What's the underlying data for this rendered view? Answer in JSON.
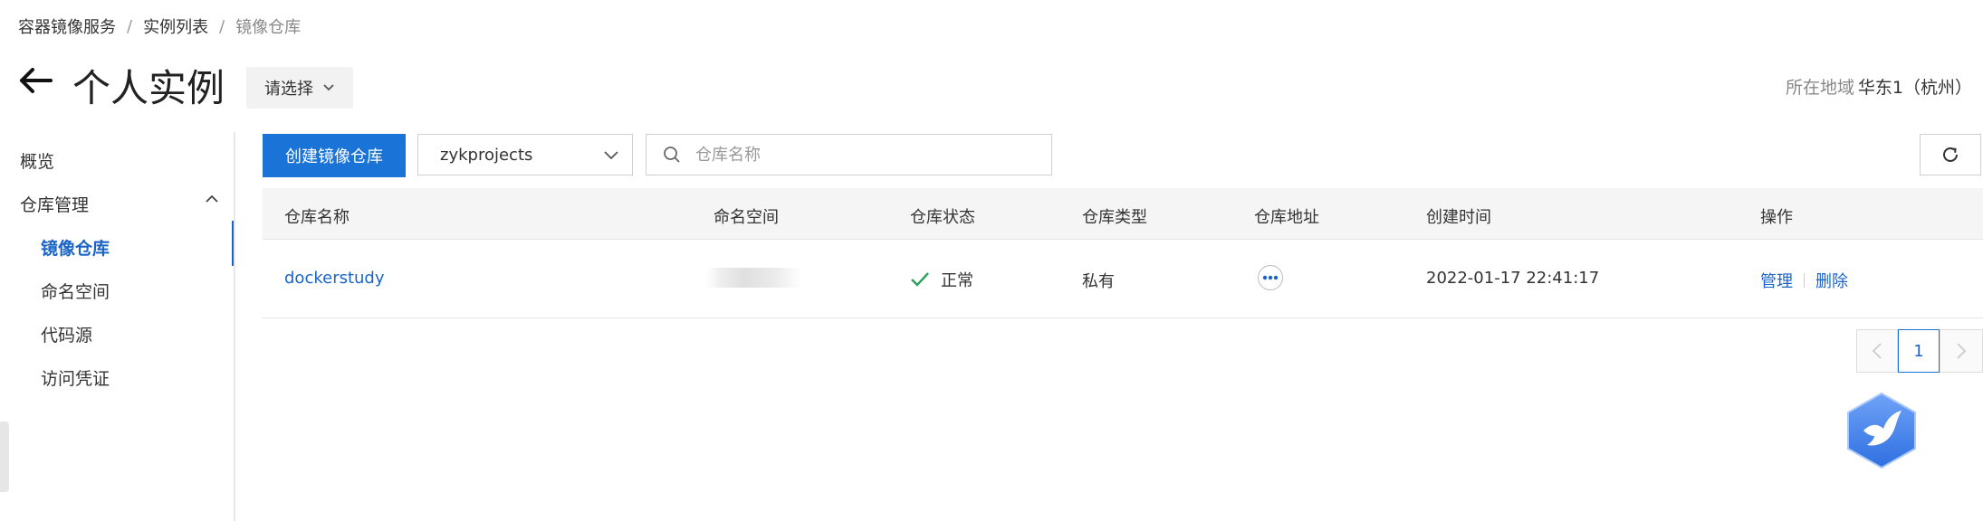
{
  "breadcrumb": [
    "容器镜像服务",
    "实例列表",
    "镜像仓库"
  ],
  "header": {
    "title": "个人实例",
    "instance_select": "请选择",
    "region_label": "所在地域",
    "region_value": "华东1（杭州）"
  },
  "sidebar": {
    "overview": "概览",
    "repo_mgmt": "仓库管理",
    "items": [
      "镜像仓库",
      "命名空间",
      "代码源",
      "访问凭证"
    ],
    "active_index": 0
  },
  "toolbar": {
    "create_label": "创建镜像仓库",
    "namespace_value": "zykprojects",
    "search_placeholder": "仓库名称"
  },
  "table": {
    "columns": [
      "仓库名称",
      "命名空间",
      "仓库状态",
      "仓库类型",
      "仓库地址",
      "创建时间",
      "操作"
    ],
    "rows": [
      {
        "name": "dockerstudy",
        "status": "正常",
        "type": "私有",
        "created": "2022-01-17 22:41:17",
        "actions": [
          "管理",
          "删除"
        ]
      }
    ]
  },
  "pagination": {
    "current": "1"
  },
  "colors": {
    "primary": "#1a74d8",
    "link": "#1a64c8",
    "success": "#2aa15a"
  },
  "icons": [
    "back-arrow-icon",
    "chevron-down-icon",
    "chevron-up-icon",
    "search-icon",
    "refresh-icon",
    "check-icon",
    "more-icon",
    "chevron-left-icon",
    "chevron-right-icon",
    "bird-assistant-icon"
  ]
}
